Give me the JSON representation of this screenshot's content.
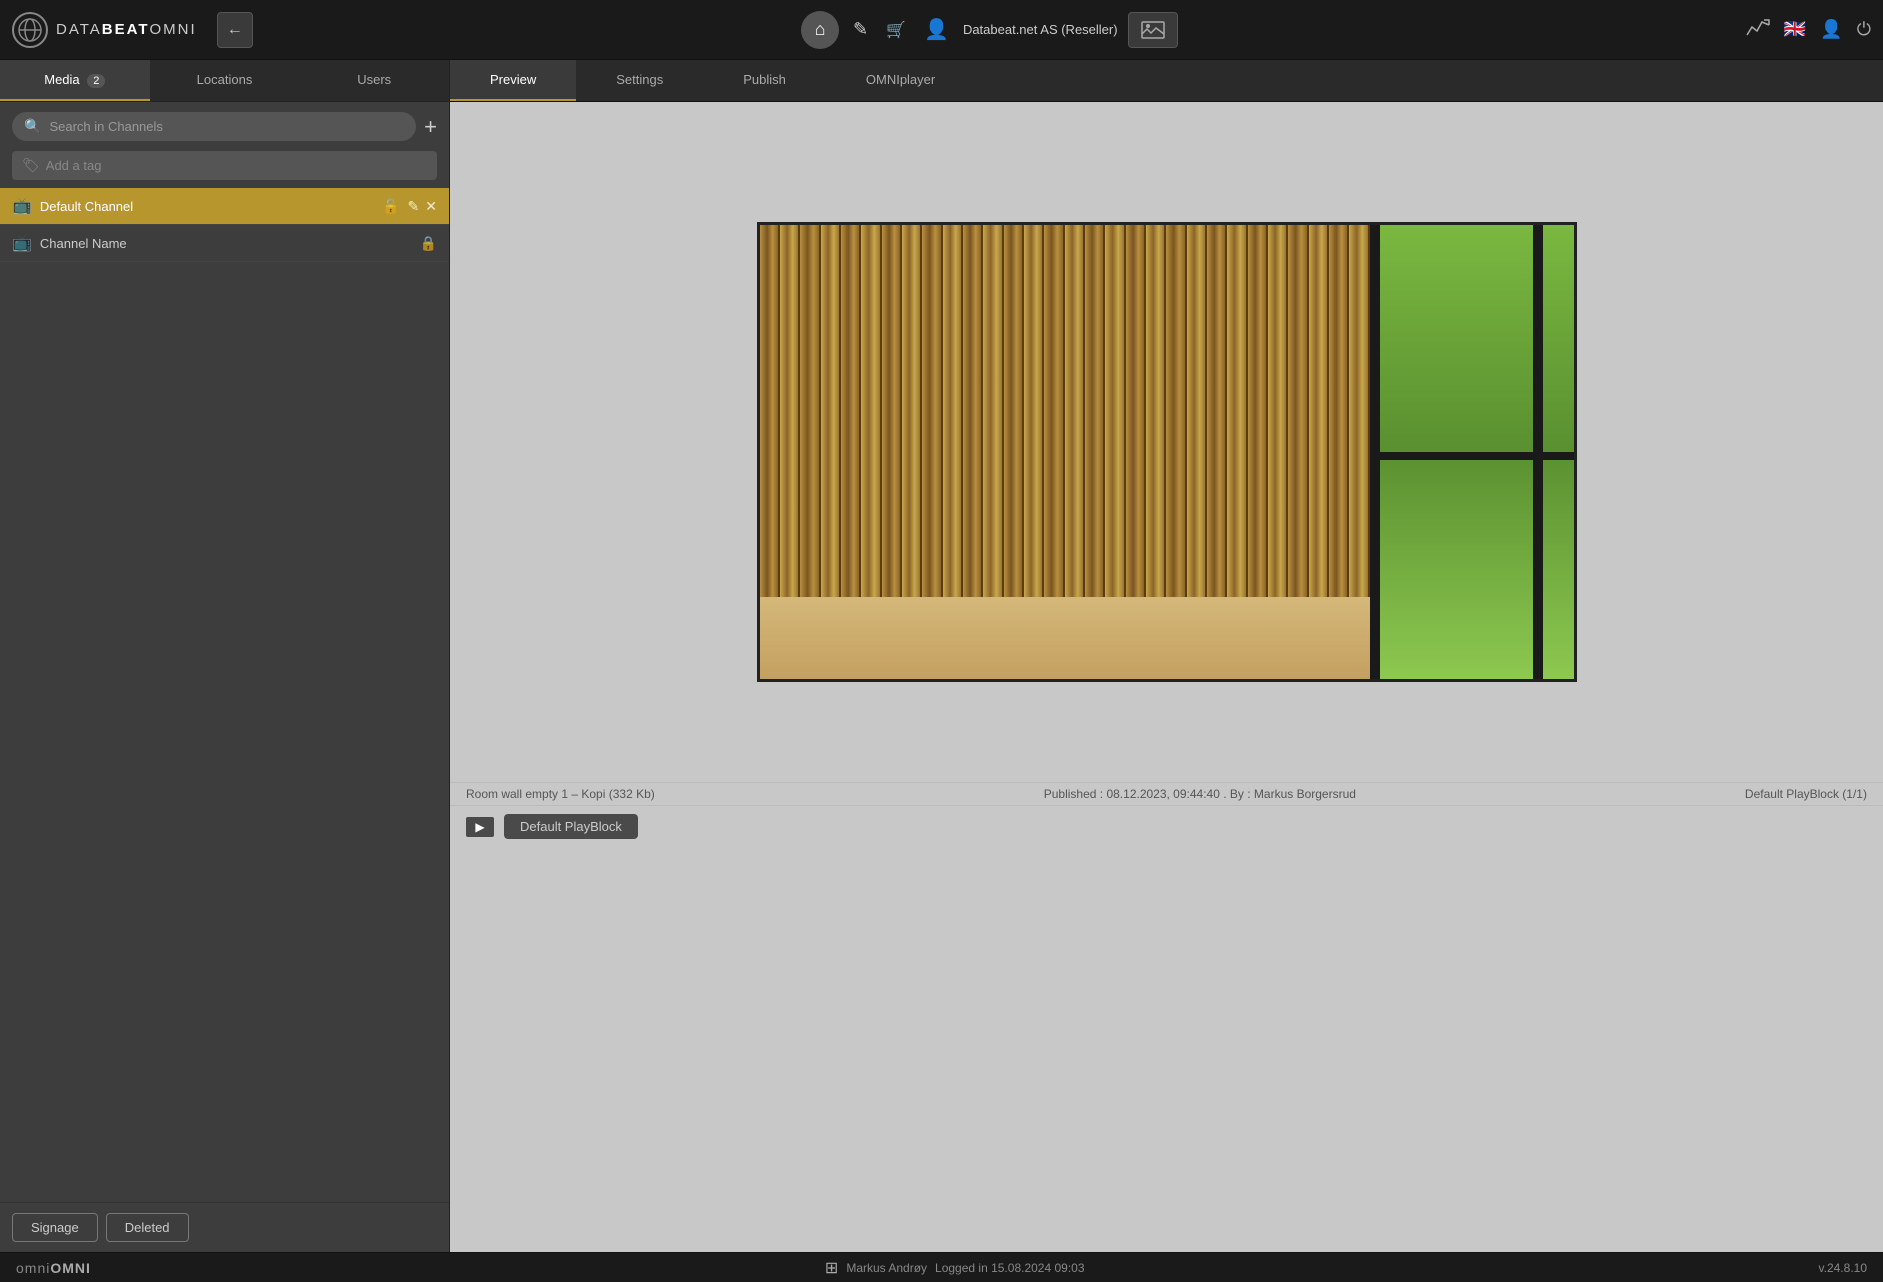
{
  "app": {
    "name": "DATABEAT",
    "name_bold": "OMNI",
    "version": "v.24.8.10"
  },
  "navbar": {
    "back_label": "←",
    "company": "Databeat.net AS (Reseller)",
    "home_icon": "⌂",
    "edit_icon": "✎",
    "cart_icon": "🛒",
    "user_icon": "👤",
    "image_icon": "🖼",
    "analytics_icon": "~",
    "flag_icon": "🇬🇧",
    "person_icon": "👤",
    "power_icon": "⏻",
    "screen_icon": "⊞"
  },
  "sidebar": {
    "tabs": [
      {
        "id": "media",
        "label": "Media",
        "badge": "2",
        "active": true
      },
      {
        "id": "locations",
        "label": "Locations",
        "active": false
      },
      {
        "id": "users",
        "label": "Users",
        "active": false
      }
    ],
    "search_placeholder": "Search in Channels",
    "tag_placeholder": "Add a tag",
    "channels": [
      {
        "id": "default",
        "name": "Default Channel",
        "active": true,
        "locked": false
      },
      {
        "id": "channel-name",
        "name": "Channel Name",
        "active": false,
        "locked": true
      }
    ],
    "footer_buttons": [
      {
        "id": "signage",
        "label": "Signage"
      },
      {
        "id": "deleted",
        "label": "Deleted"
      }
    ]
  },
  "content": {
    "tabs": [
      {
        "id": "preview",
        "label": "Preview",
        "active": true
      },
      {
        "id": "settings",
        "label": "Settings",
        "active": false
      },
      {
        "id": "publish",
        "label": "Publish",
        "active": false
      },
      {
        "id": "omniplayer",
        "label": "OMNIplayer",
        "active": false
      }
    ],
    "preview": {
      "image_alt": "Room wall empty",
      "info_left": "Room wall empty 1 – Kopi (332 Kb)",
      "info_center": "Published : 08.12.2023, 09:44:40 . By : Markus Borgersrud",
      "info_right": "Default PlayBlock (1/1)",
      "playblock_label": "Default PlayBlock"
    }
  },
  "statusbar": {
    "brand": "OMNI",
    "brand_prefix": "omni",
    "ms_icon": "⊞",
    "user": "Markus Andrøy",
    "login_text": "Logged in 15.08.2024 09:03",
    "version": "v.24.8.10"
  }
}
